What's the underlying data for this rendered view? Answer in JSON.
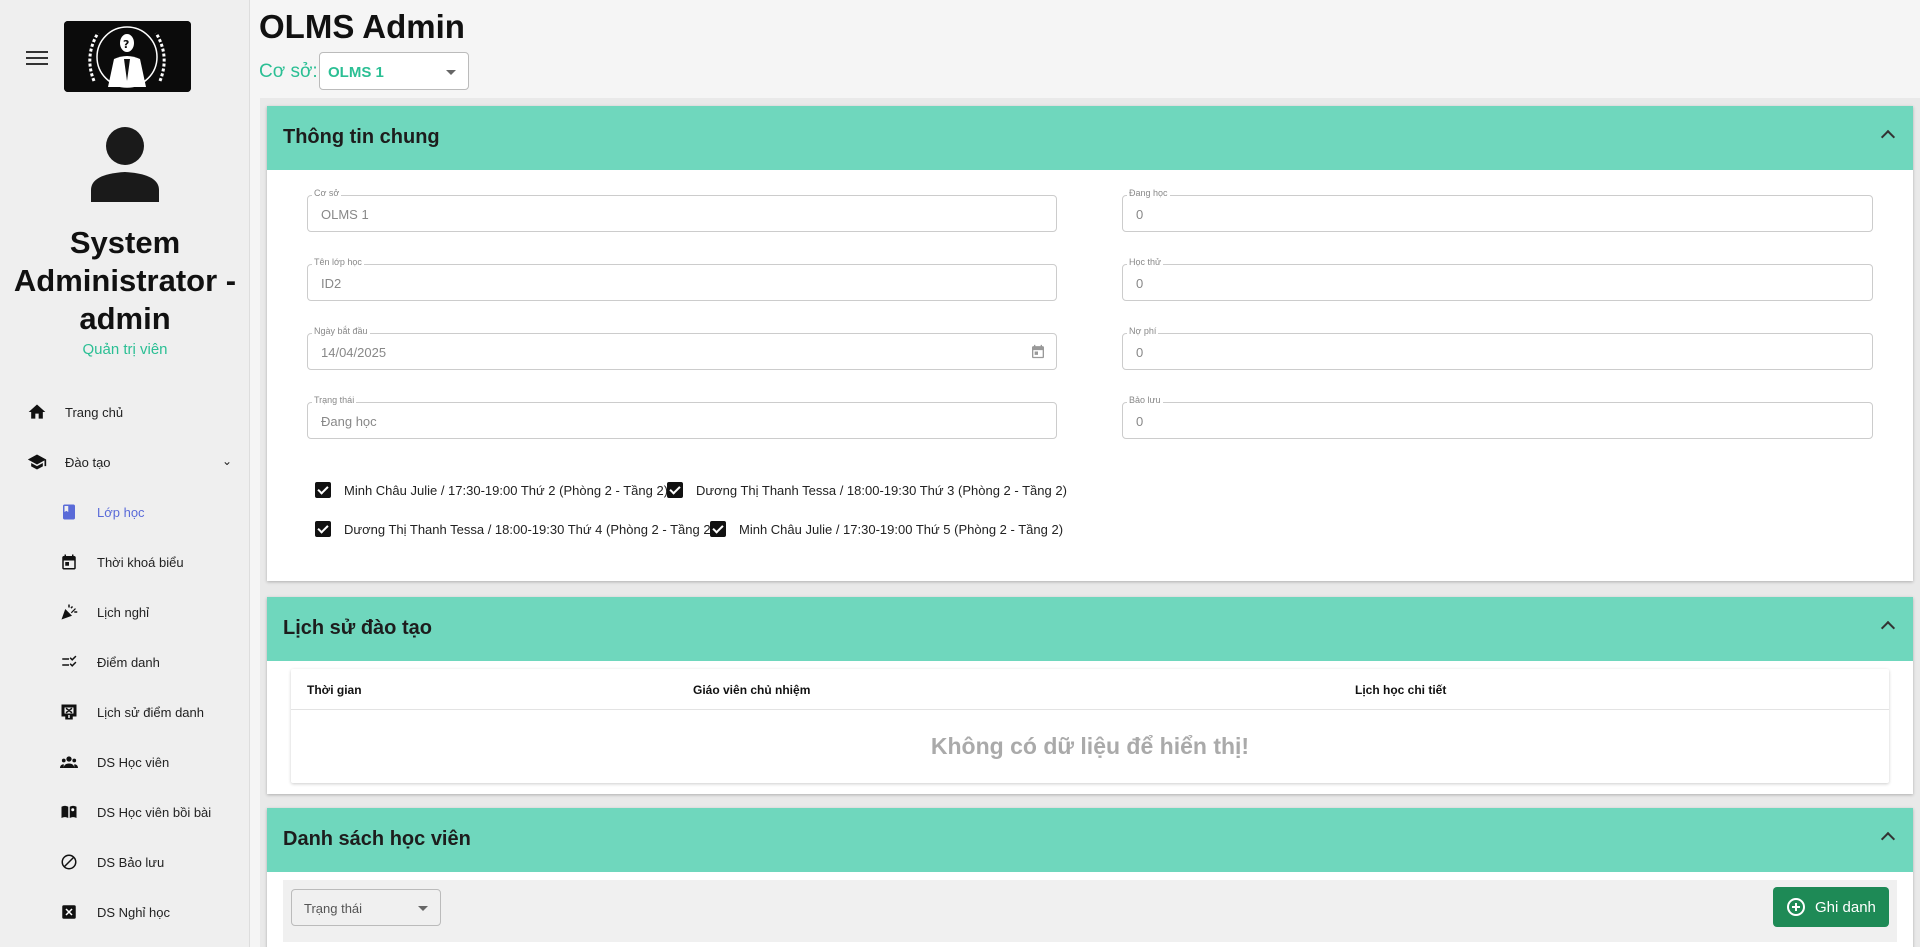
{
  "header": {
    "title": "OLMS Admin",
    "coso_label": "Cơ sở:",
    "coso_value": "OLMS 1"
  },
  "user": {
    "name": "System Administrator - admin",
    "role": "Quản trị viên"
  },
  "nav": {
    "home": "Trang chủ",
    "training": "Đào tạo",
    "sub": [
      "Lớp học",
      "Thời khoá biểu",
      "Lịch nghỉ",
      "Điểm danh",
      "Lịch sử điểm danh",
      "DS Học viên",
      "DS Học viên bồi bài",
      "DS Bảo lưu",
      "DS Nghỉ học"
    ]
  },
  "general": {
    "title": "Thông tin chung",
    "fields_left": [
      {
        "label": "Cơ sở",
        "value": "OLMS 1"
      },
      {
        "label": "Tên lớp học",
        "value": "ID2"
      },
      {
        "label": "Ngày bắt đầu",
        "value": "14/04/2025"
      },
      {
        "label": "Trạng thái",
        "value": "Đang học"
      }
    ],
    "fields_right": [
      {
        "label": "Đang học",
        "value": "0"
      },
      {
        "label": "Học thử",
        "value": "0"
      },
      {
        "label": "Nợ phí",
        "value": "0"
      },
      {
        "label": "Bảo lưu",
        "value": "0"
      }
    ],
    "schedules": [
      "Minh Châu Julie / 17:30-19:00 Thứ 2 (Phòng 2 - Tầng 2)",
      "Dương Thị Thanh Tessa / 18:00-19:30 Thứ 3 (Phòng 2 - Tầng 2)",
      "Dương Thị Thanh Tessa / 18:00-19:30 Thứ 4 (Phòng 2 - Tầng 2)",
      "Minh Châu Julie / 17:30-19:00 Thứ 5 (Phòng 2 - Tầng 2)"
    ]
  },
  "history": {
    "title": "Lịch sử đào tạo",
    "columns": [
      "Thời gian",
      "Giáo viên chủ nhiệm",
      "Lịch học chi tiết"
    ],
    "empty": "Không có dữ liệu để hiển thị!"
  },
  "students": {
    "title": "Danh sách học viên",
    "status_placeholder": "Trạng thái",
    "enroll_label": "Ghi danh"
  }
}
